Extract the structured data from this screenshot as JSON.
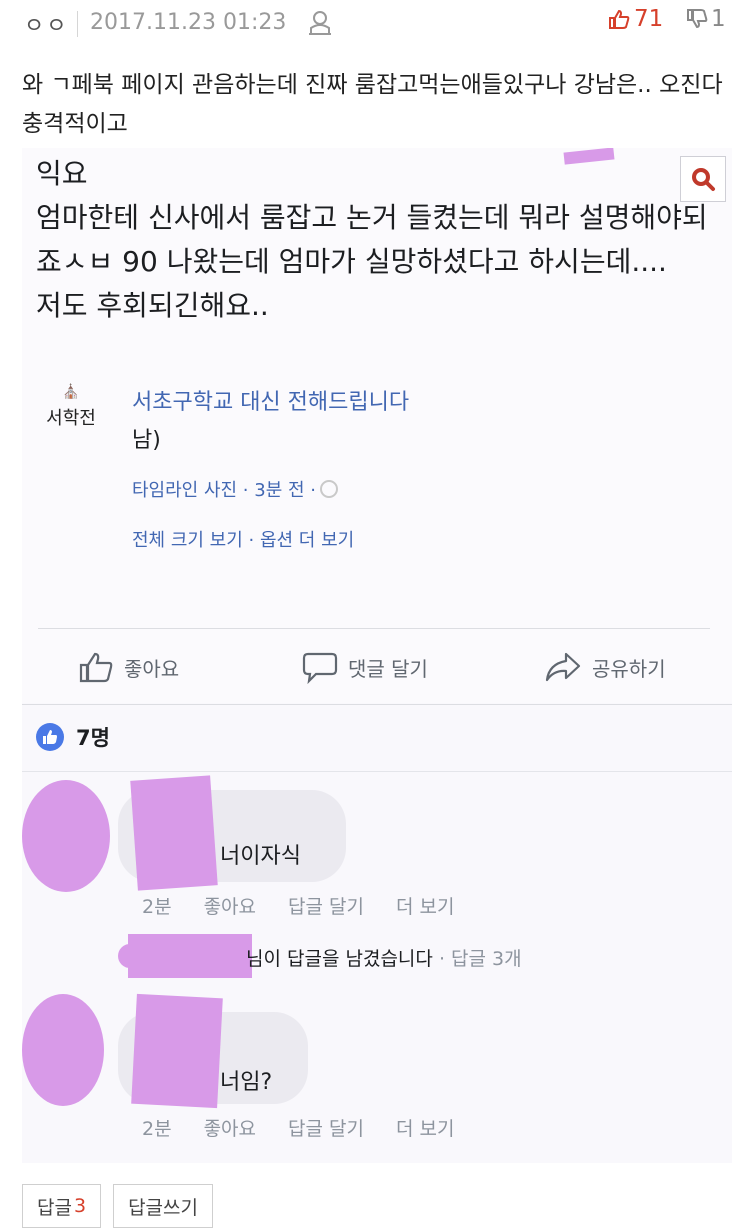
{
  "header": {
    "author": "ㅇㅇ",
    "date": "2017.11.23 01:23",
    "upvotes": "71",
    "downvotes": "1"
  },
  "post": {
    "text": "와 ㄱ페북 페이지 관음하는데 진짜 룸잡고먹는애들있구나 강남은.. 오진다 충격적이고"
  },
  "screenshot": {
    "body_text": "익요\n엄마한테 신사에서 룸잡고 논거 들켰는데 뭐라 설명해야되죠ㅅㅂ 90 나왔는데 엄마가 실망하셨다고 하시는데....\n저도 후회되긴해요..",
    "page_logo_text": "서학전",
    "page_name": "서초구학교 대신 전해드립니다",
    "page_sub": "남)",
    "meta": "타임라인 사진 · 3분 전 ·",
    "meta_links": "전체 크기 보기 · 옵션 더 보기",
    "actions": {
      "like": "좋아요",
      "comment": "댓글 달기",
      "share": "공유하기"
    },
    "likes_count": "7명",
    "comments": [
      {
        "text": "너이자식",
        "time": "2분",
        "like": "좋아요",
        "reply": "답글 달기",
        "more": "더 보기"
      },
      {
        "text": "너임?",
        "time": "2분",
        "like": "좋아요",
        "reply": "답글 달기",
        "more": "더 보기"
      }
    ],
    "reply_note": "님이 답글을 남겼습니다",
    "reply_count": "· 답글 3개"
  },
  "footer": {
    "reply_label": "답글",
    "reply_count": "3",
    "write_label": "답글쓰기"
  },
  "colors": {
    "accent_red": "#d6402b",
    "facebook_blue": "#4267b2",
    "redaction": "#d89ae8"
  }
}
